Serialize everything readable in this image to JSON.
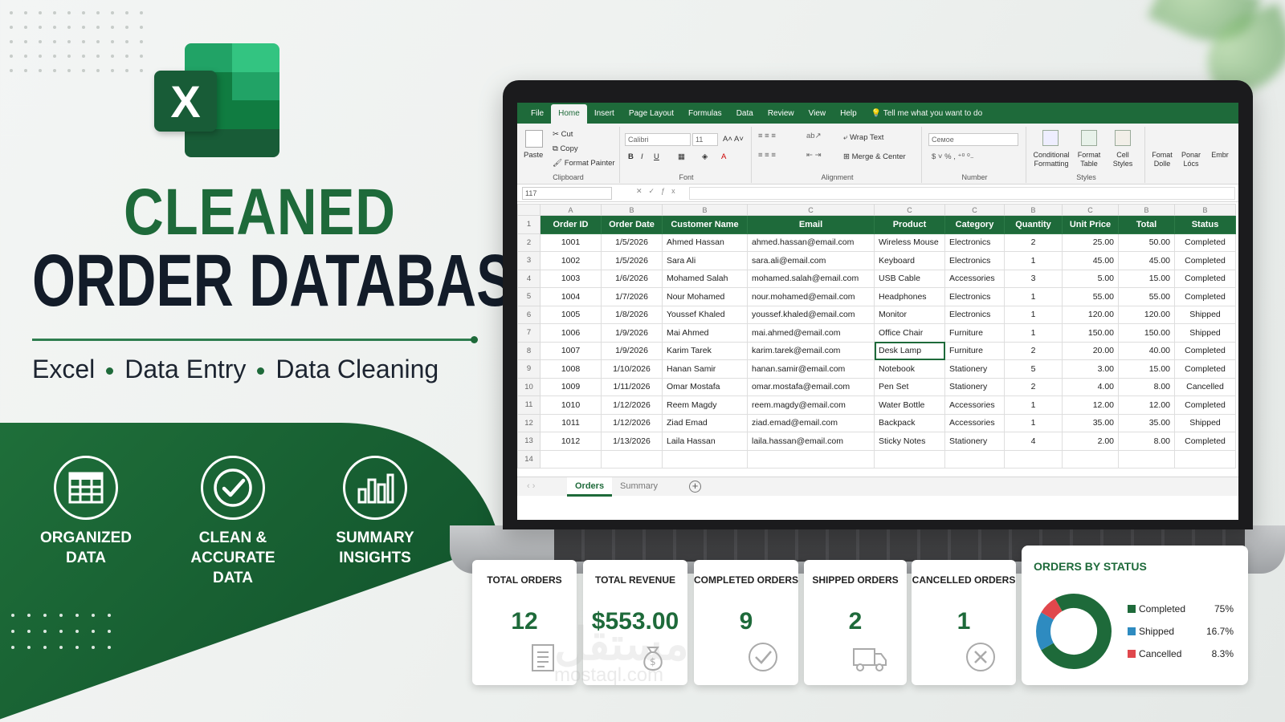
{
  "hero": {
    "title_line1": "CLEANED",
    "title_line2": "ORDER DATABASE",
    "tagline": [
      "Excel",
      "Data Entry",
      "Data Cleaning"
    ],
    "logo_letter": "X"
  },
  "features": [
    {
      "icon": "table-icon",
      "label": "ORGANIZED\nDATA"
    },
    {
      "icon": "checkmark-circle-icon",
      "label": "CLEAN & ACCURATE\nDATA"
    },
    {
      "icon": "bar-chart-icon",
      "label": "SUMMARY\nINSIGHTS"
    }
  ],
  "excel": {
    "tabs": [
      "File",
      "Home",
      "Insert",
      "Page Layout",
      "Formulas",
      "Data",
      "Review",
      "View",
      "Help"
    ],
    "active_tab": "Home",
    "tell_me": "Tell me what you want to do",
    "clipboard": {
      "paste": "Paste",
      "cut": "Cut",
      "copy": "Copy",
      "format_painter": "Format Painter",
      "group": "Clipboard"
    },
    "font": {
      "name": "Calibri",
      "size": "11",
      "group": "Font"
    },
    "alignment": {
      "wrap": "Wrap Text",
      "merge": "Merge & Center",
      "group": "Alignment"
    },
    "number": {
      "format": "Ceмoe",
      "group": "Number"
    },
    "styles": {
      "conditional": "Conditional Formatting",
      "format_table": "Format Table",
      "cell_styles": "Cell Styles",
      "group": "Styles"
    },
    "cells": {
      "format": "Fomat Dolle",
      "ponar": "Ponar Lócs",
      "emkr": "Embr"
    },
    "name_box": "117",
    "col_letters": [
      "A",
      "B",
      "B",
      "C",
      "C",
      "C",
      "B",
      "C",
      "B",
      "B"
    ],
    "headers": [
      "Order ID",
      "Order Date",
      "Customer Name",
      "Email",
      "Product",
      "Category",
      "Quantity",
      "Unit Price",
      "Total",
      "Status"
    ],
    "rows": [
      [
        "1001",
        "1/5/2026",
        "Ahmed Hassan",
        "ahmed.hassan@email.com",
        "Wireless Mouse",
        "Electronics",
        "2",
        "25.00",
        "50.00",
        "Completed"
      ],
      [
        "1002",
        "1/5/2026",
        "Sara Ali",
        "sara.ali@email.com",
        "Keyboard",
        "Electronics",
        "1",
        "45.00",
        "45.00",
        "Completed"
      ],
      [
        "1003",
        "1/6/2026",
        "Mohamed Salah",
        "mohamed.salah@email.com",
        "USB Cable",
        "Accessories",
        "3",
        "5.00",
        "15.00",
        "Completed"
      ],
      [
        "1004",
        "1/7/2026",
        "Nour Mohamed",
        "nour.mohamed@email.com",
        "Headphones",
        "Electronics",
        "1",
        "55.00",
        "55.00",
        "Completed"
      ],
      [
        "1005",
        "1/8/2026",
        "Youssef Khaled",
        "youssef.khaled@email.com",
        "Monitor",
        "Electronics",
        "1",
        "120.00",
        "120.00",
        "Shipped"
      ],
      [
        "1006",
        "1/9/2026",
        "Mai Ahmed",
        "mai.ahmed@email.com",
        "Office Chair",
        "Furniture",
        "1",
        "150.00",
        "150.00",
        "Shipped"
      ],
      [
        "1007",
        "1/9/2026",
        "Karim Tarek",
        "karim.tarek@email.com",
        "Desk Lamp",
        "Furniture",
        "2",
        "20.00",
        "40.00",
        "Completed"
      ],
      [
        "1008",
        "1/10/2026",
        "Hanan Samir",
        "hanan.samir@email.com",
        "Notebook",
        "Stationery",
        "5",
        "3.00",
        "15.00",
        "Completed"
      ],
      [
        "1009",
        "1/11/2026",
        "Omar Mostafa",
        "omar.mostafa@email.com",
        "Pen Set",
        "Stationery",
        "2",
        "4.00",
        "8.00",
        "Cancelled"
      ],
      [
        "1010",
        "1/12/2026",
        "Reem Magdy",
        "reem.magdy@email.com",
        "Water Bottle",
        "Accessories",
        "1",
        "12.00",
        "12.00",
        "Completed"
      ],
      [
        "1011",
        "1/12/2026",
        "Ziad Emad",
        "ziad.emad@email.com",
        "Backpack",
        "Accessories",
        "1",
        "35.00",
        "35.00",
        "Shipped"
      ],
      [
        "1012",
        "1/13/2026",
        "Laila Hassan",
        "laila.hassan@email.com",
        "Sticky Notes",
        "Stationery",
        "4",
        "2.00",
        "8.00",
        "Completed"
      ]
    ],
    "sheet_tabs": [
      "Orders",
      "Summary"
    ],
    "active_sheet": "Orders"
  },
  "kpis": [
    {
      "title": "TOTAL ORDERS",
      "value": "12",
      "icon": "document-list-icon"
    },
    {
      "title": "TOTAL REVENUE",
      "value": "$553.00",
      "icon": "money-bag-icon"
    },
    {
      "title": "COMPLETED ORDERS",
      "value": "9",
      "icon": "check-circle-icon"
    },
    {
      "title": "SHIPPED ORDERS",
      "value": "2",
      "icon": "truck-icon"
    },
    {
      "title": "CANCELLED ORDERS",
      "value": "1",
      "icon": "x-circle-icon"
    }
  ],
  "status_chart": {
    "title": "ORDERS BY STATUS",
    "chart_data": {
      "type": "pie",
      "categories": [
        "Completed",
        "Shipped",
        "Cancelled"
      ],
      "values": [
        75,
        16.7,
        8.3
      ],
      "labels": [
        "75%",
        "16.7%",
        "8.3%"
      ],
      "colors": [
        "#1e6a3a",
        "#2e8bc0",
        "#e0474c"
      ],
      "legend": "right"
    }
  },
  "watermark": {
    "arabic": "مستقل",
    "latin": "mostaql.com"
  },
  "colors": {
    "brand_green": "#1e6a3a",
    "dark_text": "#131c29"
  }
}
